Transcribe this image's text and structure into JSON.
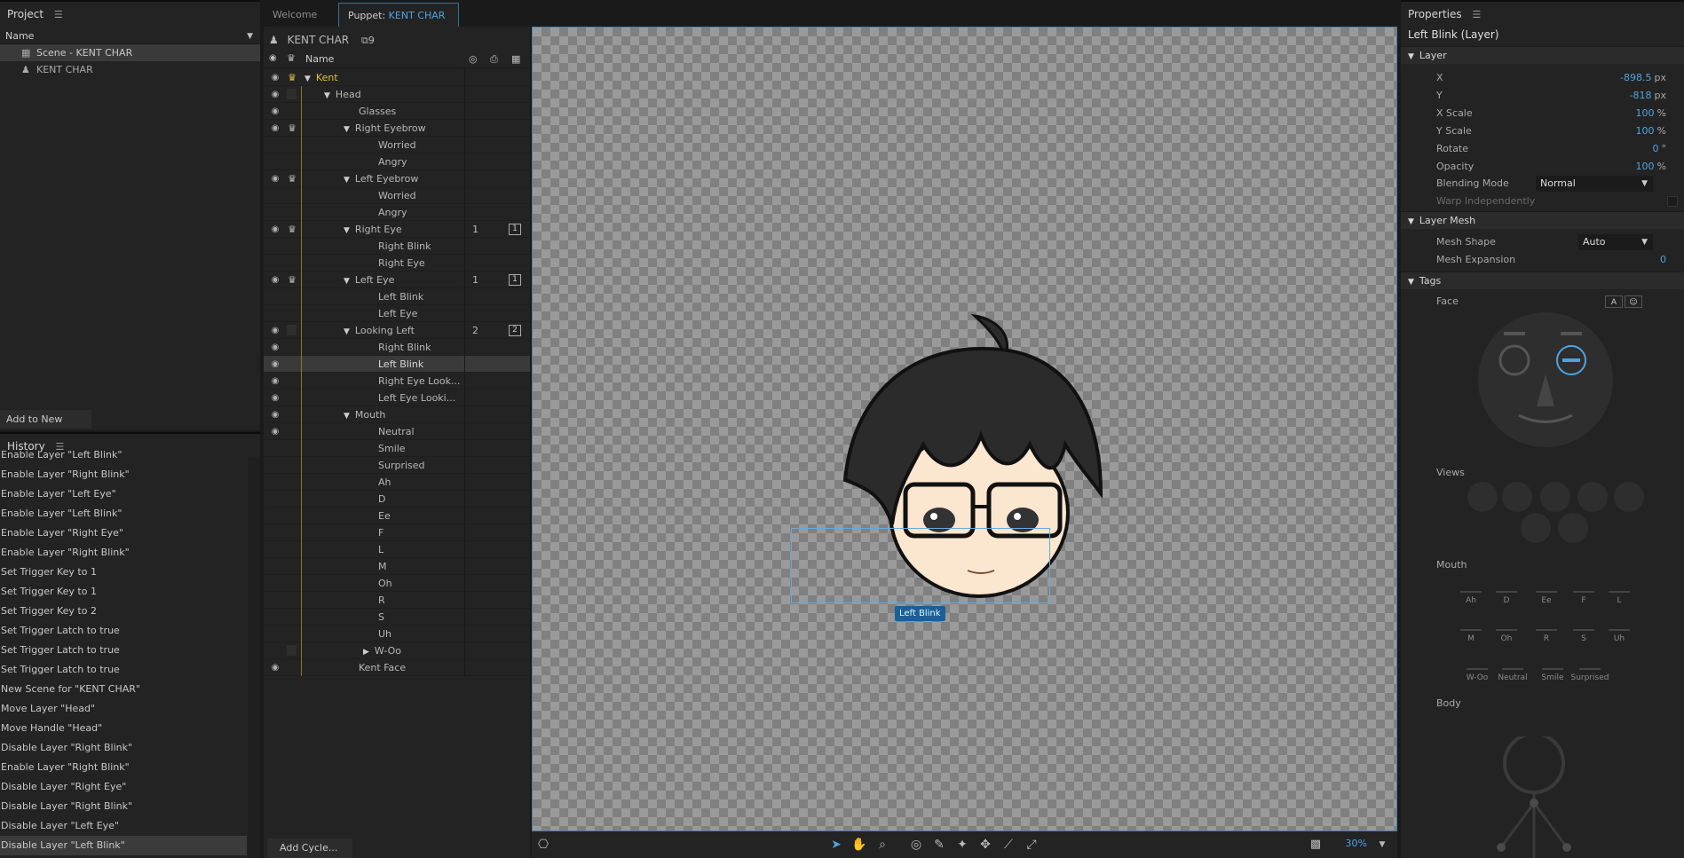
{
  "project": {
    "title": "Project",
    "column_name": "Name",
    "items": [
      {
        "label": "Scene - KENT CHAR",
        "selected": true
      },
      {
        "label": "KENT CHAR",
        "selected": false
      }
    ],
    "add_to_new_scene": "Add to New Scene"
  },
  "history": {
    "title": "History",
    "items": [
      "Enable Layer \"Left Blink\"",
      "Enable Layer \"Right Blink\"",
      "Enable Layer \"Left Eye\"",
      "Enable Layer \"Left Blink\"",
      "Enable Layer \"Right Eye\"",
      "Enable Layer \"Right Blink\"",
      "Set Trigger Key to 1",
      "Set Trigger Key to 1",
      "Set Trigger Key to 2",
      "Set Trigger Latch to true",
      "Set Trigger Latch to true",
      "Set Trigger Latch to true",
      "New Scene for \"KENT CHAR\"",
      "Move Layer \"Head\"",
      "Move Handle \"Head\"",
      "Disable Layer \"Right Blink\"",
      "Enable Layer \"Right Blink\"",
      "Disable Layer \"Right Eye\"",
      "Disable Layer \"Right Blink\"",
      "Disable Layer \"Left Eye\"",
      "Disable Layer \"Left Blink\""
    ]
  },
  "tabs": {
    "welcome": "Welcome",
    "puppet_prefix": "Puppet:",
    "puppet_name": "KENT CHAR"
  },
  "puppet": {
    "name": "KENT CHAR",
    "count": "9",
    "col_name": "Name",
    "add_cycle": "Add Cycle...",
    "layers": [
      {
        "label": "Kent",
        "indent": 0,
        "tri": true,
        "eye": true,
        "crown": "gold",
        "num": "",
        "sq": ""
      },
      {
        "label": "Head",
        "indent": 1,
        "tri": true,
        "eye": true,
        "crown": "box",
        "num": "",
        "sq": ""
      },
      {
        "label": "Glasses",
        "indent": 2,
        "tri": false,
        "eye": true,
        "crown": "",
        "num": "",
        "sq": ""
      },
      {
        "label": "Right Eyebrow",
        "indent": 2,
        "tri": true,
        "eye": true,
        "crown": "crown",
        "num": "",
        "sq": ""
      },
      {
        "label": "Worried",
        "indent": 3,
        "tri": false,
        "eye": false,
        "crown": "",
        "num": "",
        "sq": ""
      },
      {
        "label": "Angry",
        "indent": 3,
        "tri": false,
        "eye": false,
        "crown": "",
        "num": "",
        "sq": ""
      },
      {
        "label": "Left Eyebrow",
        "indent": 2,
        "tri": true,
        "eye": true,
        "crown": "crown",
        "num": "",
        "sq": ""
      },
      {
        "label": "Worried",
        "indent": 3,
        "tri": false,
        "eye": false,
        "crown": "",
        "num": "",
        "sq": ""
      },
      {
        "label": "Angry",
        "indent": 3,
        "tri": false,
        "eye": false,
        "crown": "",
        "num": "",
        "sq": ""
      },
      {
        "label": "Right Eye",
        "indent": 2,
        "tri": true,
        "eye": true,
        "crown": "crown",
        "num": "1",
        "sq": "1"
      },
      {
        "label": "Right Blink",
        "indent": 3,
        "tri": false,
        "eye": false,
        "crown": "",
        "num": "",
        "sq": ""
      },
      {
        "label": "Right Eye",
        "indent": 3,
        "tri": false,
        "eye": false,
        "crown": "",
        "num": "",
        "sq": ""
      },
      {
        "label": "Left Eye",
        "indent": 2,
        "tri": true,
        "eye": true,
        "crown": "crown",
        "num": "1",
        "sq": "1"
      },
      {
        "label": "Left Blink",
        "indent": 3,
        "tri": false,
        "eye": false,
        "crown": "",
        "num": "",
        "sq": ""
      },
      {
        "label": "Left Eye",
        "indent": 3,
        "tri": false,
        "eye": false,
        "crown": "",
        "num": "",
        "sq": ""
      },
      {
        "label": "Looking Left",
        "indent": 2,
        "tri": true,
        "eye": true,
        "crown": "box",
        "num": "2",
        "sq": "2"
      },
      {
        "label": "Right Blink",
        "indent": 3,
        "tri": false,
        "eye": true,
        "crown": "",
        "num": "",
        "sq": ""
      },
      {
        "label": "Left Blink",
        "indent": 3,
        "tri": false,
        "eye": true,
        "crown": "",
        "num": "",
        "sq": "",
        "selected": true
      },
      {
        "label": "Right Eye Look...",
        "indent": 3,
        "tri": false,
        "eye": true,
        "crown": "",
        "num": "",
        "sq": ""
      },
      {
        "label": "Left Eye Looki...",
        "indent": 3,
        "tri": false,
        "eye": true,
        "crown": "",
        "num": "",
        "sq": ""
      },
      {
        "label": "Mouth",
        "indent": 2,
        "tri": true,
        "eye": true,
        "crown": "",
        "num": "",
        "sq": ""
      },
      {
        "label": "Neutral",
        "indent": 3,
        "tri": false,
        "eye": true,
        "crown": "",
        "num": "",
        "sq": ""
      },
      {
        "label": "Smile",
        "indent": 3,
        "tri": false,
        "eye": false,
        "crown": "",
        "num": "",
        "sq": ""
      },
      {
        "label": "Surprised",
        "indent": 3,
        "tri": false,
        "eye": false,
        "crown": "",
        "num": "",
        "sq": ""
      },
      {
        "label": "Ah",
        "indent": 3,
        "tri": false,
        "eye": false,
        "crown": "",
        "num": "",
        "sq": ""
      },
      {
        "label": "D",
        "indent": 3,
        "tri": false,
        "eye": false,
        "crown": "",
        "num": "",
        "sq": ""
      },
      {
        "label": "Ee",
        "indent": 3,
        "tri": false,
        "eye": false,
        "crown": "",
        "num": "",
        "sq": ""
      },
      {
        "label": "F",
        "indent": 3,
        "tri": false,
        "eye": false,
        "crown": "",
        "num": "",
        "sq": ""
      },
      {
        "label": "L",
        "indent": 3,
        "tri": false,
        "eye": false,
        "crown": "",
        "num": "",
        "sq": ""
      },
      {
        "label": "M",
        "indent": 3,
        "tri": false,
        "eye": false,
        "crown": "",
        "num": "",
        "sq": ""
      },
      {
        "label": "Oh",
        "indent": 3,
        "tri": false,
        "eye": false,
        "crown": "",
        "num": "",
        "sq": ""
      },
      {
        "label": "R",
        "indent": 3,
        "tri": false,
        "eye": false,
        "crown": "",
        "num": "",
        "sq": ""
      },
      {
        "label": "S",
        "indent": 3,
        "tri": false,
        "eye": false,
        "crown": "",
        "num": "",
        "sq": ""
      },
      {
        "label": "Uh",
        "indent": 3,
        "tri": false,
        "eye": false,
        "crown": "",
        "num": "",
        "sq": ""
      },
      {
        "label": "W-Oo",
        "indent": 3,
        "tri": "closed",
        "eye": false,
        "crown": "box",
        "num": "",
        "sq": ""
      },
      {
        "label": "Kent Face",
        "indent": 2,
        "tri": false,
        "eye": true,
        "crown": "",
        "num": "",
        "sq": ""
      }
    ]
  },
  "canvas": {
    "selection_label": "Left Blink",
    "zoom": "30%"
  },
  "properties": {
    "title": "Properties",
    "selection": "Left Blink (Layer)",
    "layer_section": "Layer",
    "rows": [
      {
        "label": "X",
        "value": "-898.5",
        "unit": "px"
      },
      {
        "label": "Y",
        "value": "-818",
        "unit": "px"
      },
      {
        "label": "X Scale",
        "value": "100",
        "unit": "%"
      },
      {
        "label": "Y Scale",
        "value": "100",
        "unit": "%"
      },
      {
        "label": "Rotate",
        "value": "0",
        "unit": "°"
      },
      {
        "label": "Opacity",
        "value": "100",
        "unit": "%"
      }
    ],
    "blending_mode_label": "Blending Mode",
    "blending_mode_value": "Normal",
    "warp_independently": "Warp Independently",
    "layer_mesh_section": "Layer Mesh",
    "mesh_shape_label": "Mesh Shape",
    "mesh_shape_value": "Auto",
    "mesh_expansion_label": "Mesh Expansion",
    "mesh_expansion_value": "0",
    "tags_section": "Tags",
    "face_label": "Face",
    "face_btn_a": "A",
    "views_label": "Views",
    "mouth_label": "Mouth",
    "mouth_items": [
      "Ah",
      "D",
      "Ee",
      "F",
      "L",
      "M",
      "Oh",
      "R",
      "S",
      "Uh",
      "W-Oo",
      "Neutral",
      "Smile",
      "Surprised"
    ],
    "body_label": "Body"
  },
  "colors": {
    "accent": "#4fa3e0",
    "crown_gold": "#e0c040",
    "selection_blue": "#1b5f96"
  }
}
